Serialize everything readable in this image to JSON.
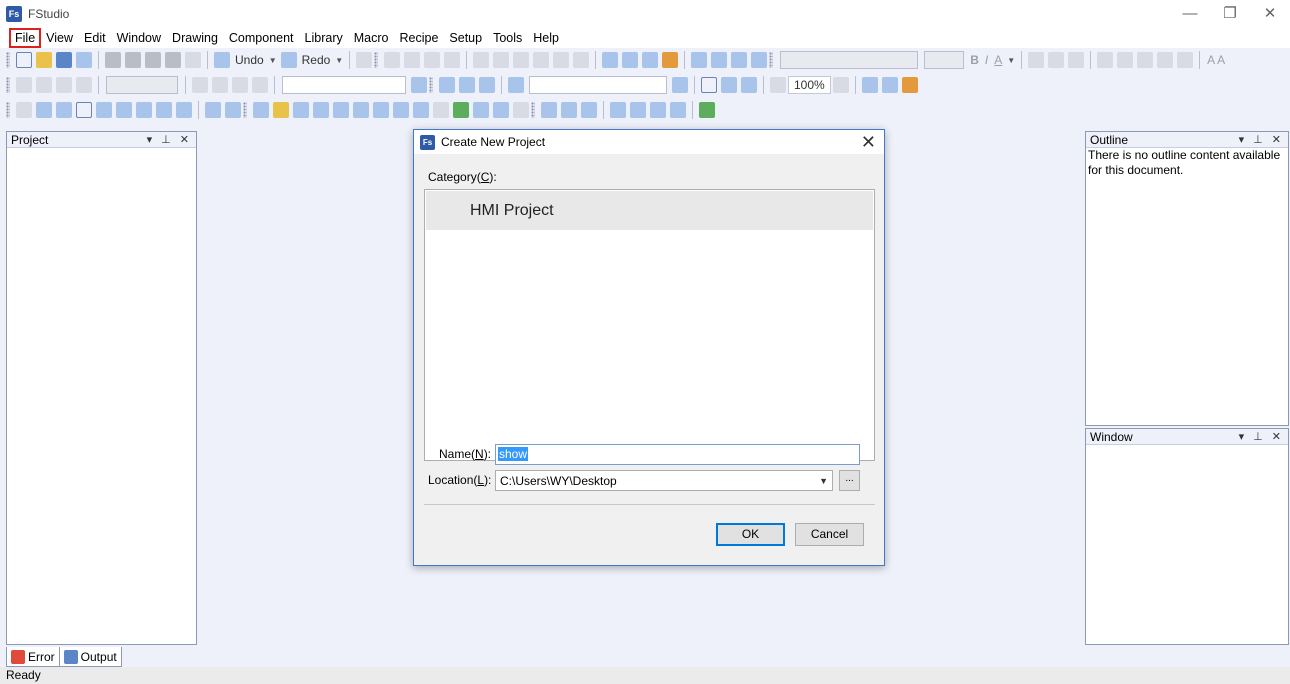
{
  "app": {
    "title": "FStudio",
    "icon_text": "Fs"
  },
  "window_controls": {
    "minimize": "—",
    "maximize": "❐",
    "close": "✕"
  },
  "menu": [
    "File",
    "View",
    "Edit",
    "Window",
    "Drawing",
    "Component",
    "Library",
    "Macro",
    "Recipe",
    "Setup",
    "Tools",
    "Help"
  ],
  "toolbar": {
    "undo": "Undo",
    "redo": "Redo",
    "zoom": "100%",
    "bold": "B",
    "italic": "I",
    "font_color": "A",
    "text_aa": "A A"
  },
  "panels": {
    "project": {
      "title": "Project",
      "buttons": "▾ ⊥ ✕"
    },
    "outline": {
      "title": "Outline",
      "buttons": "▾ ⊥ ✕",
      "message": "There is no outline content available for this document."
    },
    "window": {
      "title": "Window",
      "buttons": "▾ ⊥ ✕"
    }
  },
  "bottom_tabs": [
    "Error",
    "Output"
  ],
  "status": "Ready",
  "dialog": {
    "title": "Create New Project",
    "category_label": "Category(",
    "category_key": "C",
    "category_suffix": "):",
    "categories": [
      "HMI Project"
    ],
    "name_label": "Name(",
    "name_key": "N",
    "name_suffix": "):",
    "name_value": "show",
    "location_label": "Location(",
    "location_key": "L",
    "location_suffix": "):",
    "location_value": "C:\\Users\\WY\\Desktop",
    "browse": "...",
    "ok": "OK",
    "cancel": "Cancel"
  },
  "colors": {
    "accent": "#0078d7",
    "highlight": "#3399ff",
    "menu_highlight": "#e02020",
    "workspace": "#eef0fa"
  }
}
